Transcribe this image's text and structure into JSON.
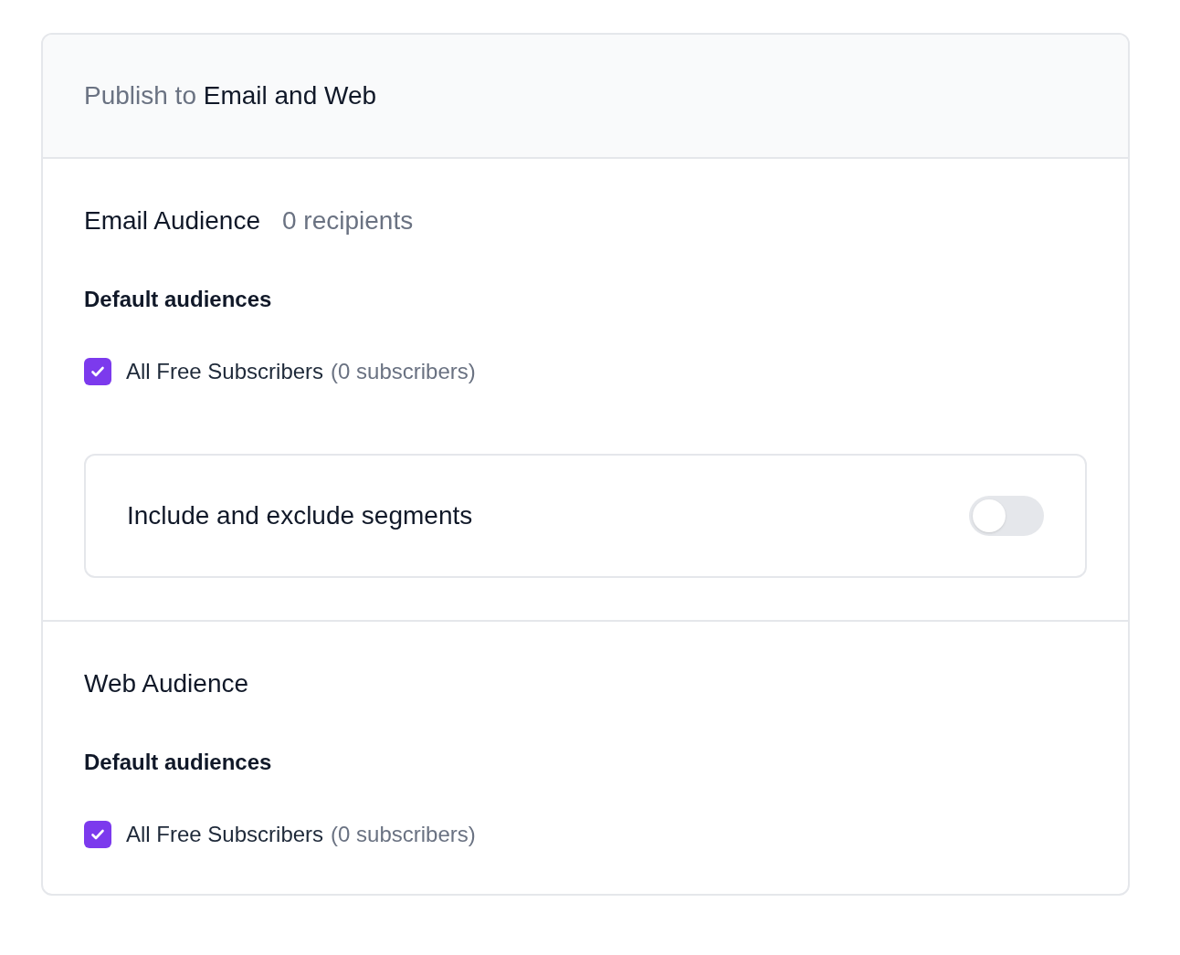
{
  "header": {
    "title": "Publish to **Email and Web**"
  },
  "sections": [
    {
      "heading": "Email Audience",
      "recipients": "0 recipients",
      "subheading": "Default audiences",
      "audiences": [
        {
          "label": "All Free Subscribers",
          "count": "(0 subscribers)",
          "checked": true
        }
      ],
      "segments": {
        "label": "Include and exclude segments",
        "on": false
      }
    },
    {
      "heading": "Web Audience",
      "subheading": "Default audiences",
      "audiences": [
        {
          "label": "All Free Subscribers",
          "count": "(0 subscribers)",
          "checked": true
        }
      ]
    }
  ]
}
